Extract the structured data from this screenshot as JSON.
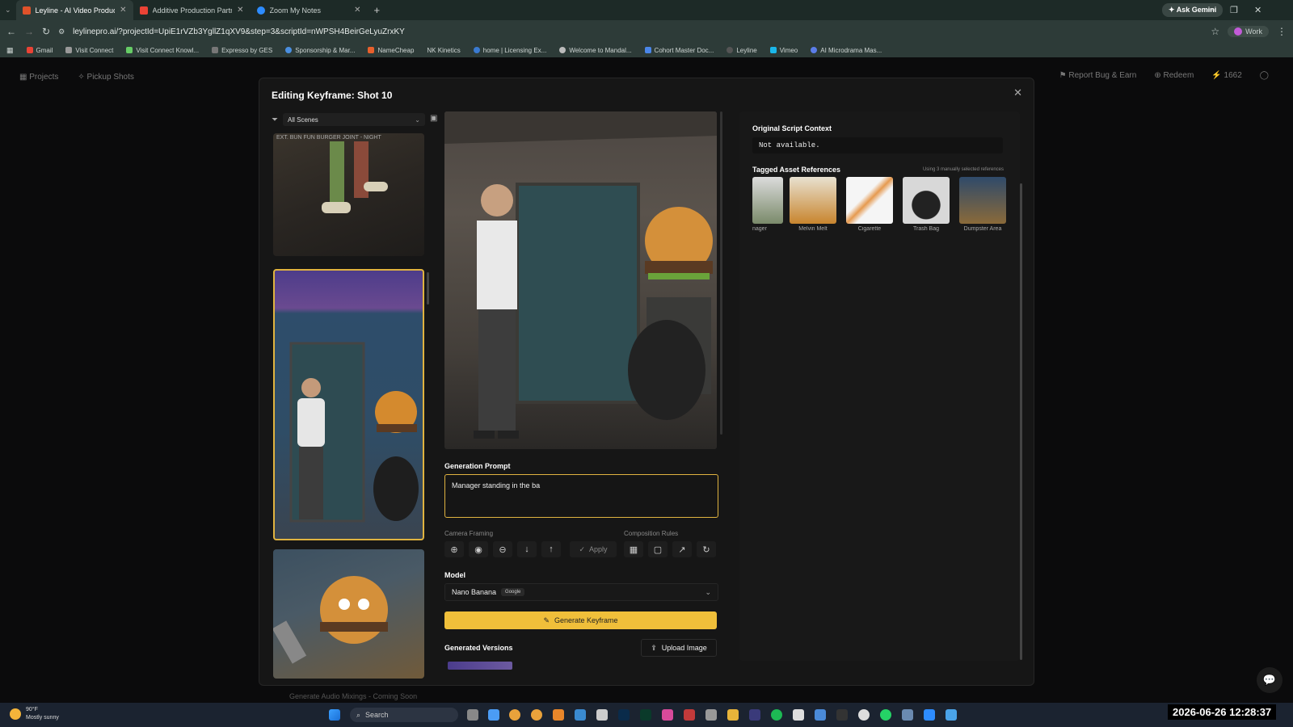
{
  "browser": {
    "tabs": [
      {
        "label": "Leyline - AI Video Production Pl",
        "active": true,
        "color": "#e0522a"
      },
      {
        "label": "Additive Production Partner - n",
        "active": false,
        "color": "#ea4335"
      },
      {
        "label": "Zoom My Notes",
        "active": false,
        "color": "#2d8cff"
      }
    ],
    "url": "leylinepro.ai/?projectId=UpiE1rVZb3YgllZ1qXV9&step=3&scriptId=nWPSH4BeirGeLyuZrxKY",
    "ask_gemini": "Ask Gemini",
    "profile": "Work",
    "bookmarks": [
      "Gmail",
      "Visit Connect",
      "Visit Connect Knowl...",
      "Expresso by GES",
      "Sponsorship & Mar...",
      "NameCheap",
      "NK Kinetics",
      "home | Licensing Ex...",
      "Welcome to Mandal...",
      "Cohort Master Doc...",
      "Leyline",
      "Vimeo",
      "AI Microdrama Mas..."
    ]
  },
  "app_header": {
    "projects": "Projects",
    "pickup_shots": "Pickup Shots",
    "report_bug": "Report Bug & Earn",
    "redeem": "Redeem",
    "credits": "1662"
  },
  "modal": {
    "title": "Editing Keyframe: Shot 10",
    "scene_filter": "All Scenes",
    "thumb1_label": "EXT. BUN FUN BURGER JOINT - NIGHT",
    "generation_prompt_label": "Generation Prompt",
    "generation_prompt_value": "Manager standing in the ba",
    "camera_framing_label": "Camera Framing",
    "composition_rules_label": "Composition Rules",
    "apply_label": "Apply",
    "model_label": "Model",
    "model_value": "Nano Banana",
    "model_badge": "Google",
    "generate_label": "Generate Keyframe",
    "generated_versions_label": "Generated Versions",
    "upload_label": "Upload Image",
    "original_script_label": "Original Script Context",
    "original_script_value": "Not available.",
    "tagged_assets_label": "Tagged Asset References",
    "tagged_assets_note": "Using 3 manually selected references",
    "assets": [
      {
        "name": "nager",
        "color1": "#dcdcdc",
        "color2": "#7a8a6a"
      },
      {
        "name": "Melvin Melt",
        "color1": "#e8e1d0",
        "color2": "#c8852e"
      },
      {
        "name": "Cigarette",
        "color1": "#f5f5f5",
        "color2": "#e69a50"
      },
      {
        "name": "Trash Bag",
        "color1": "#d8d8d8",
        "color2": "#222222"
      },
      {
        "name": "Dumpster Area",
        "color1": "#2f4a6a",
        "color2": "#8a6a3a"
      }
    ]
  },
  "coming_soon": "Generate Audio Mixings - Coming Soon",
  "taskbar": {
    "temp": "90°F",
    "weather": "Mostly sunny",
    "search": "Search",
    "clock": "2026-06-26 12:28:37",
    "date_small": "6/26/2026"
  },
  "colors": {
    "accent": "#f0bf3a",
    "selected_border": "#e0b340"
  }
}
